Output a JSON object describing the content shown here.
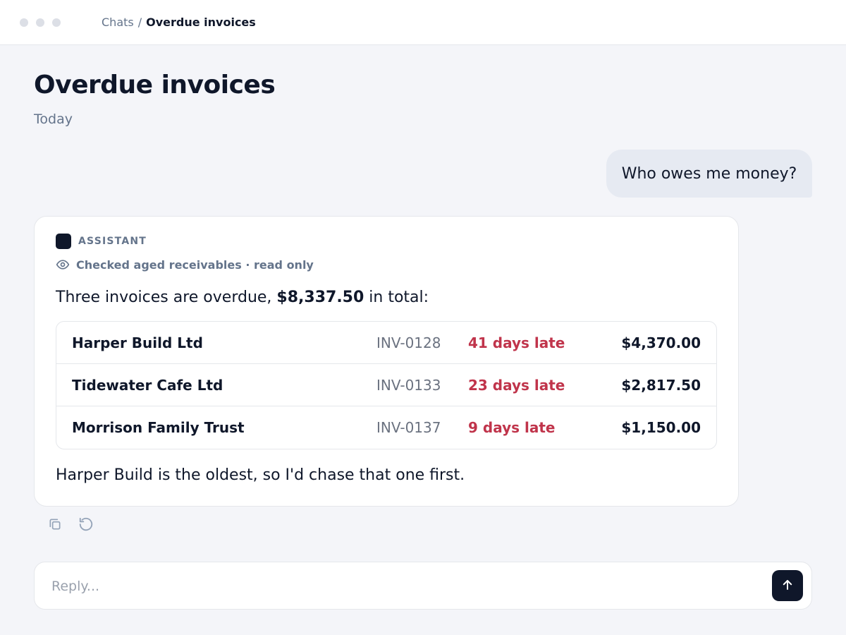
{
  "topbar": {
    "breadcrumb_root": "Chats",
    "breadcrumb_separator": "/",
    "breadcrumb_current": "Overdue invoices"
  },
  "page": {
    "title": "Overdue invoices",
    "date": "Today"
  },
  "user_message": {
    "text": "Who owes me money?"
  },
  "assistant_message": {
    "label": "ASSISTANT",
    "activity_icon": "eye-icon",
    "activity": "Checked aged receivables · read only",
    "intro_before": "Three invoices are overdue, ",
    "intro_amount": "$8,337.50",
    "intro_after": " in total:",
    "invoices": [
      {
        "customer": "Harper Build Ltd",
        "number": "INV-0128",
        "late": "41 days late",
        "amount": "$4,370.00"
      },
      {
        "customer": "Tidewater Cafe Ltd",
        "number": "INV-0133",
        "late": "23 days late",
        "amount": "$2,817.50"
      },
      {
        "customer": "Morrison Family Trust",
        "number": "INV-0137",
        "late": "9 days late",
        "amount": "$1,150.00"
      }
    ],
    "summary": "Harper Build is the oldest, so I'd chase that one first."
  },
  "message_actions": {
    "copy_icon": "copy-icon",
    "regenerate_icon": "regenerate-icon"
  },
  "composer": {
    "placeholder": "Reply...",
    "value": "",
    "send_icon": "arrow-up-icon"
  },
  "colors": {
    "background": "#f4f5f9",
    "text": "#0f172a",
    "muted": "#64748b",
    "late": "#c0344b",
    "user_bubble": "#e6eaf2",
    "accent_dark": "#0f172a"
  }
}
